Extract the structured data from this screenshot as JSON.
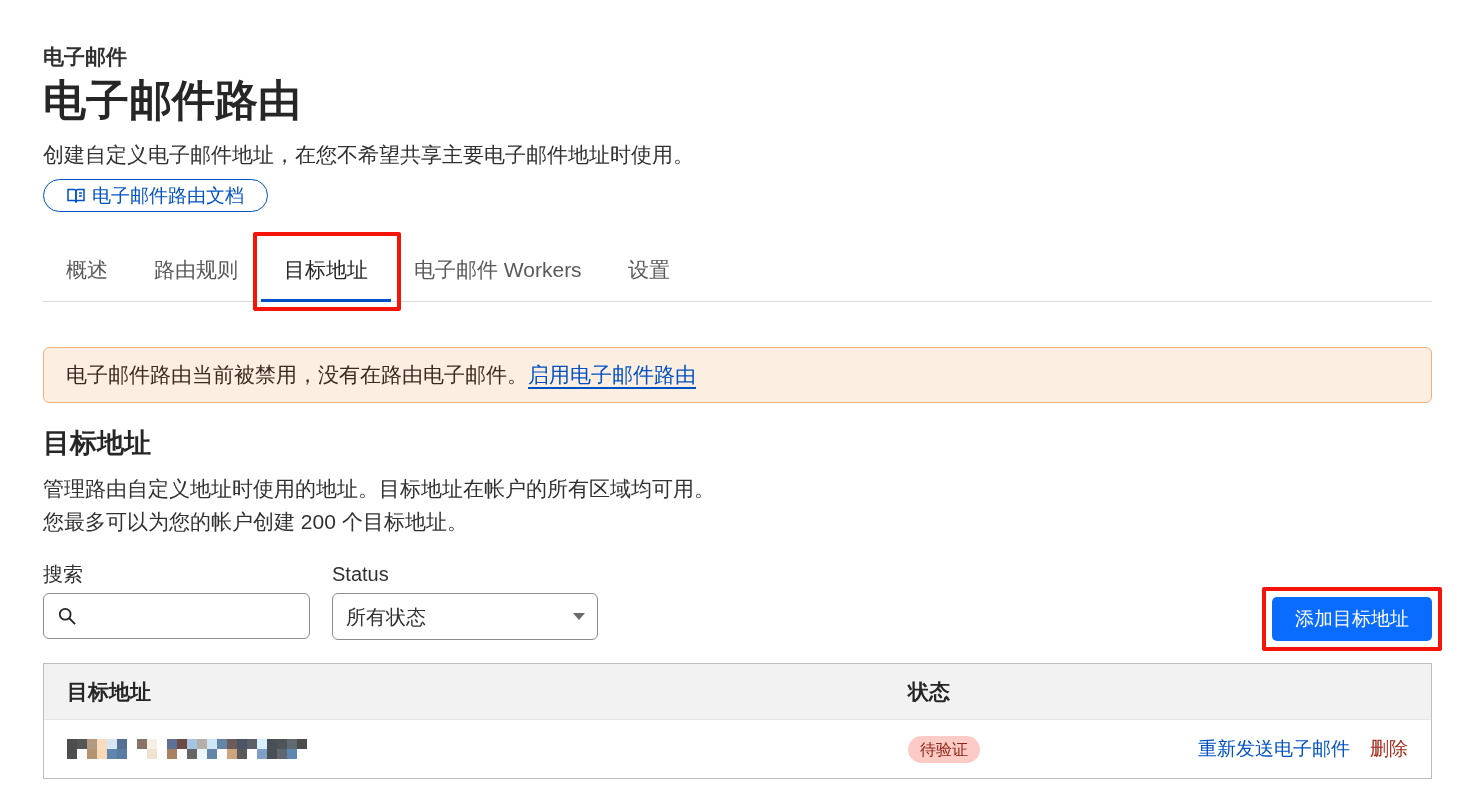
{
  "breadcrumb": "电子邮件",
  "title": "电子邮件路由",
  "description": "创建自定义电子邮件地址，在您不希望共享主要电子邮件地址时使用。",
  "docs_link": {
    "label": "电子邮件路由文档"
  },
  "tabs": [
    {
      "label": "概述",
      "selected": false,
      "highlighted": false
    },
    {
      "label": "路由规则",
      "selected": false,
      "highlighted": false
    },
    {
      "label": "目标地址",
      "selected": true,
      "highlighted": true
    },
    {
      "label": "电子邮件 Workers",
      "selected": false,
      "highlighted": false
    },
    {
      "label": "设置",
      "selected": false,
      "highlighted": false
    }
  ],
  "alert": {
    "text": "电子邮件路由当前被禁用，没有在路由电子邮件。",
    "link": "启用电子邮件路由"
  },
  "section": {
    "title": "目标地址",
    "description_lines": [
      "管理路由自定义地址时使用的地址。目标地址在帐户的所有区域均可用。",
      "您最多可以为您的帐户创建 200 个目标地址。"
    ]
  },
  "filters": {
    "search": {
      "label": "搜索"
    },
    "status": {
      "label": "Status",
      "value": "所有状态"
    }
  },
  "add_button": {
    "label": "添加目标地址",
    "highlighted": true
  },
  "table": {
    "columns": [
      "目标地址",
      "状态"
    ],
    "rows": [
      {
        "address_redacted": true,
        "status": {
          "label": "待验证",
          "kind": "pending"
        },
        "actions": [
          {
            "label": "重新发送电子邮件",
            "kind": "link"
          },
          {
            "label": "删除",
            "kind": "danger"
          }
        ]
      }
    ]
  }
}
